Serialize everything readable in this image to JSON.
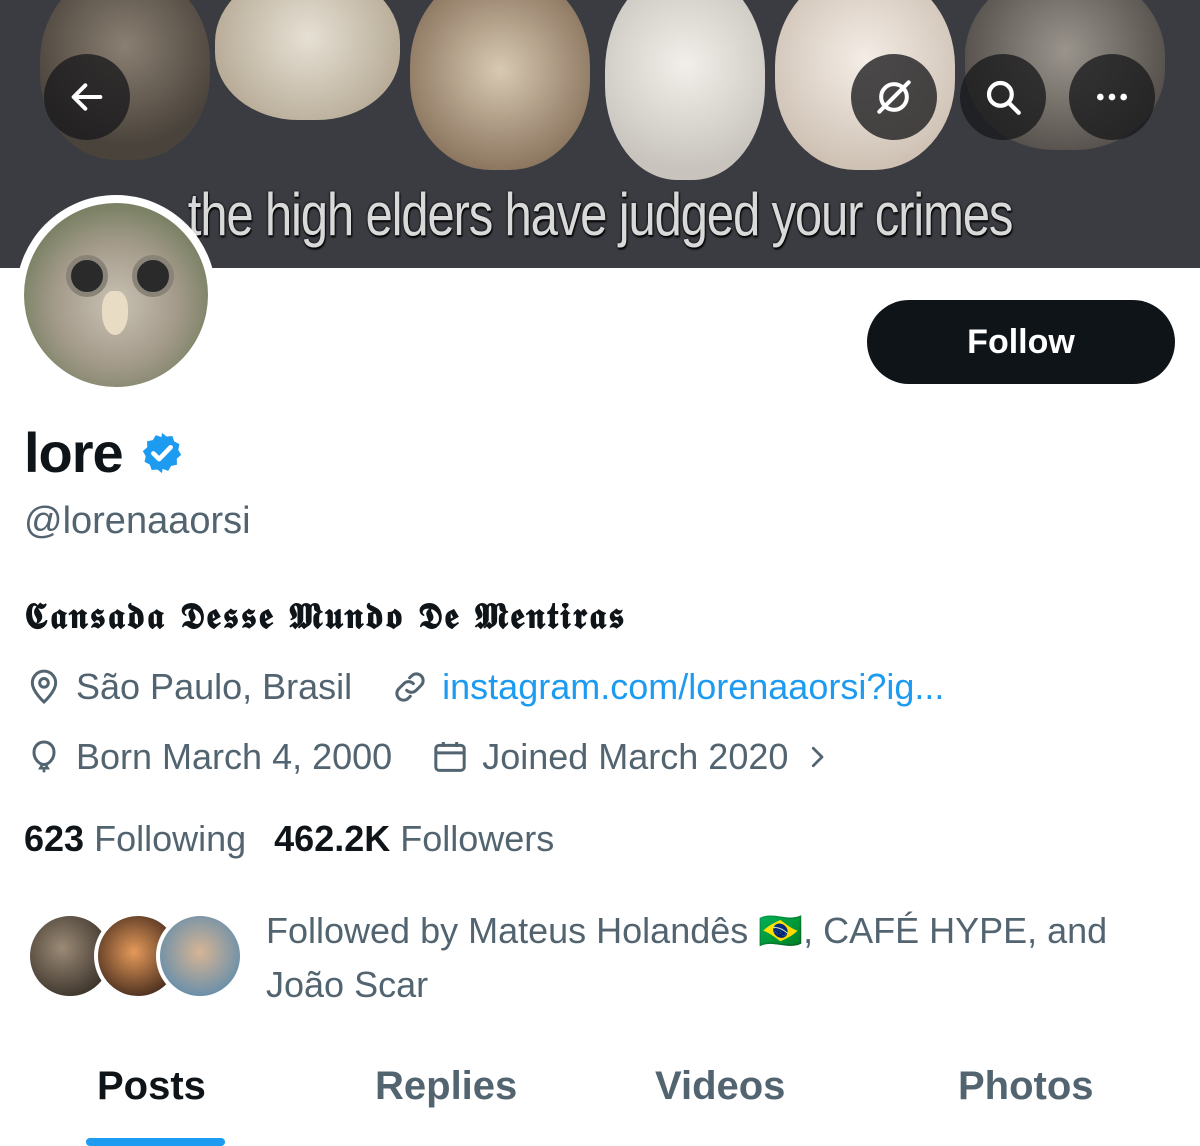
{
  "banner": {
    "caption": "the high elders have judged your crimes"
  },
  "header_buttons": {
    "back": "back-arrow-icon",
    "grok": "grok-icon",
    "search": "search-icon",
    "more": "more-icon"
  },
  "profile": {
    "display_name": "lore",
    "handle": "@lorenaaorsi",
    "bio": "𝕮𝖆𝖓𝖘𝖆𝖉𝖆 𝕯𝖊𝖘𝖘𝖊 𝕸𝖚𝖓𝖉𝖔 𝕯𝖊 𝕸𝖊𝖓𝖙𝖎𝖗𝖆𝖘",
    "location": "São Paulo, Brasil",
    "website": "instagram.com/lorenaaorsi?ig...",
    "birthday": "Born March 4, 2000",
    "joined": "Joined March 2020",
    "verified_color": "#1d9bf0"
  },
  "follow_button": {
    "label": "Follow"
  },
  "stats": {
    "following_count": "623",
    "following_label": "Following",
    "followers_count": "462.2K",
    "followers_label": "Followers"
  },
  "followed_by": {
    "text": "Followed by Mateus Holandês 🇧🇷, CAFÉ HYPE, and João Scar"
  },
  "tabs": [
    {
      "label": "Posts",
      "active": true
    },
    {
      "label": "Replies",
      "active": false
    },
    {
      "label": "Videos",
      "active": false
    },
    {
      "label": "Photos",
      "active": false
    }
  ],
  "colors": {
    "accent": "#1d9bf0",
    "text_primary": "#0f1419",
    "text_secondary": "#536471"
  }
}
